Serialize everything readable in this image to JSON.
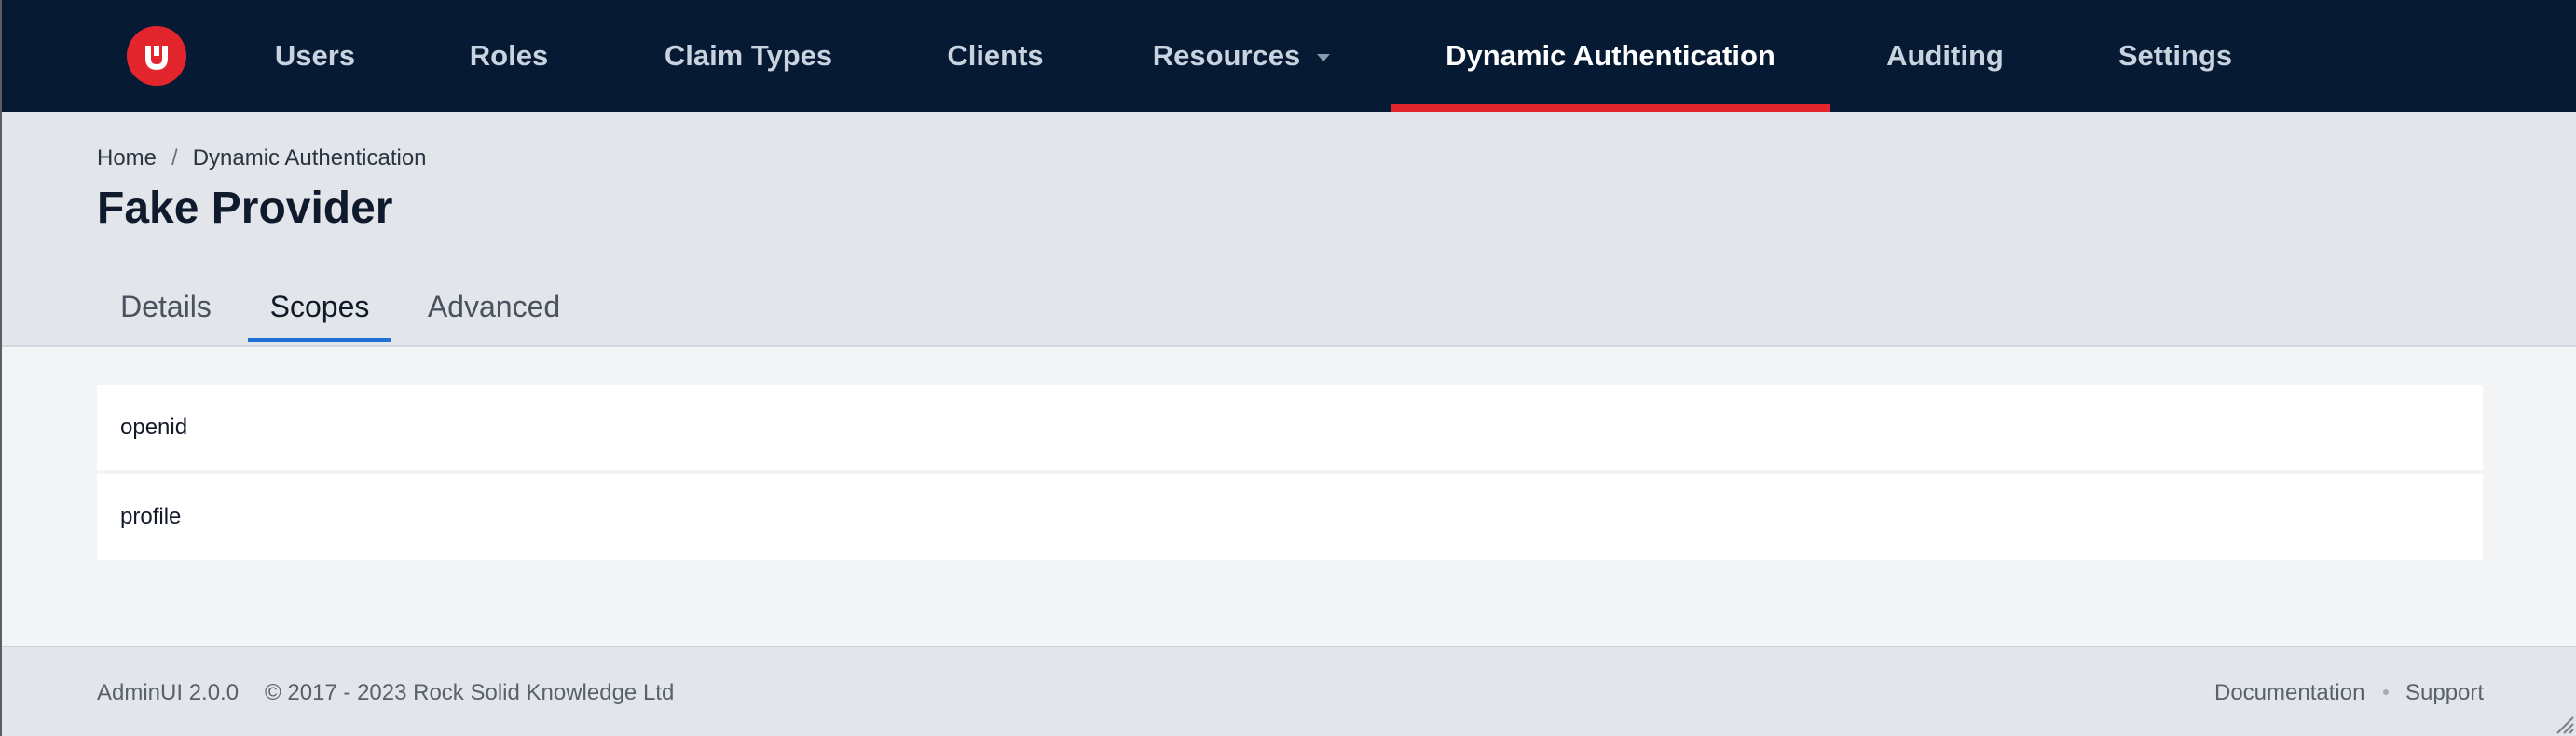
{
  "nav": {
    "logo_letter": "U",
    "items": [
      {
        "label": "Users"
      },
      {
        "label": "Roles"
      },
      {
        "label": "Claim Types"
      },
      {
        "label": "Clients"
      },
      {
        "label": "Resources"
      },
      {
        "label": "Dynamic Authentication"
      },
      {
        "label": "Auditing"
      },
      {
        "label": "Settings"
      }
    ],
    "active_item": "Dynamic Authentication"
  },
  "breadcrumb": {
    "items": [
      "Home",
      "Dynamic Authentication"
    ],
    "separator": "/"
  },
  "page": {
    "title": "Fake Provider"
  },
  "tabs": {
    "items": [
      {
        "label": "Details"
      },
      {
        "label": "Scopes"
      },
      {
        "label": "Advanced"
      }
    ],
    "active_tab": "Scopes"
  },
  "scopes": [
    {
      "name": "openid"
    },
    {
      "name": "profile"
    }
  ],
  "footer": {
    "version": "AdminUI 2.0.0",
    "copyright": "© 2017 - 2023 Rock Solid Knowledge Ltd",
    "links": [
      "Documentation",
      "Support"
    ]
  },
  "colors": {
    "nav_background": "#061a33",
    "accent_red": "#e3262e",
    "tab_accent_blue": "#1f6fd6",
    "header_band": "#e2e5e9",
    "content_background": "#f3f4f6"
  },
  "icons": {
    "logo": "brand-logo-icon",
    "resources_menu": "caret-down-icon",
    "window_resize": "resize-grip-icon"
  }
}
